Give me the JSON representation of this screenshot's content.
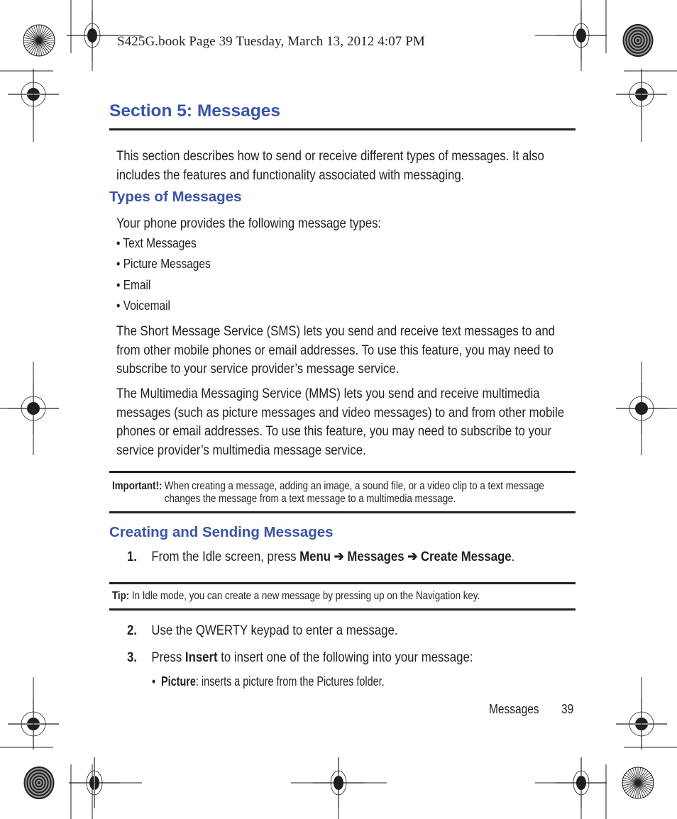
{
  "print_header": "S425G.book  Page 39  Tuesday, March 13, 2012  4:07 PM",
  "section_title": "Section 5: Messages",
  "intro": "This section describes how to send or receive different types of messages. It also includes the features and functionality associated with messaging.",
  "types": {
    "heading": "Types of Messages",
    "lead": "Your phone provides the following message types:",
    "bullets": [
      "Text Messages",
      "Picture Messages",
      "Email",
      "Voicemail"
    ],
    "sms_paragraph": "The Short Message Service (SMS) lets you send and receive text messages to and from other mobile phones or email addresses. To use this feature, you may need to subscribe to your service provider’s message service.",
    "mms_paragraph": "The Multimedia Messaging Service (MMS) lets you send and receive multimedia messages (such as picture messages and video messages) to and from other mobile phones or email addresses. To use this feature, you may need to subscribe to your service provider’s multimedia message service."
  },
  "important_note": {
    "label": "Important!:",
    "text": "When creating a message, adding an image, a sound file, or a video clip to a text message changes the message from a text message to a multimedia message."
  },
  "creating": {
    "heading": "Creating and Sending Messages",
    "steps": [
      {
        "num": "1.",
        "pre": "From the Idle screen, press ",
        "menu": "Menu",
        "arrow": " ➔ ",
        "messages": "Messages",
        "create": "Create Message",
        "post": "."
      },
      {
        "num": "2.",
        "text": "Use the QWERTY keypad to enter a message."
      },
      {
        "num": "3.",
        "pre": "Press ",
        "bold": "Insert",
        "post": " to insert one of the following into your message:"
      }
    ],
    "sub_bullet": {
      "bold": "Picture",
      "text": ": inserts a picture from the Pictures folder."
    }
  },
  "tip": {
    "label": "Tip:",
    "text": " In Idle mode, you can create a new message by pressing up on the Navigation key."
  },
  "footer": {
    "section": "Messages",
    "page": "39"
  },
  "colors": {
    "heading_blue": "#3a55a8",
    "text": "#231f20"
  }
}
